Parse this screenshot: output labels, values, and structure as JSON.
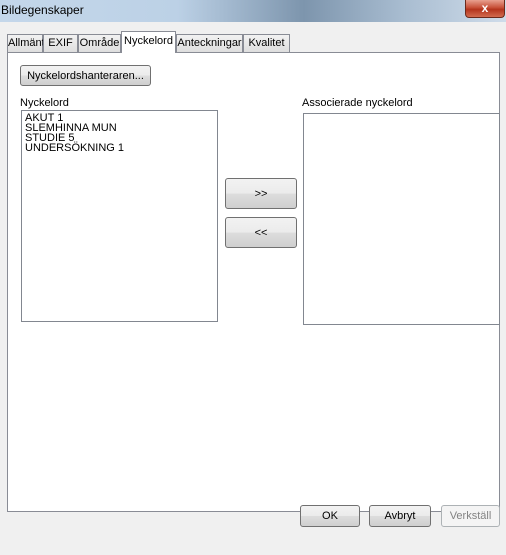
{
  "window": {
    "title": "Bildegenskaper",
    "close_icon": "close-icon",
    "close_glyph": "x"
  },
  "tabs": [
    {
      "label": "Allmänt"
    },
    {
      "label": "EXIF"
    },
    {
      "label": "Område"
    },
    {
      "label": "Nyckelord",
      "active": true
    },
    {
      "label": "Anteckningar"
    },
    {
      "label": "Kvalitet"
    }
  ],
  "panel": {
    "manager_button": "Nyckelordshanteraren...",
    "keywords_label": "Nyckelord",
    "keywords": [
      "AKUT 1",
      "SLEMHINNA MUN",
      "STUDIE 5",
      "UNDERSÖKNING 1"
    ],
    "associated_label": "Associerade nyckelord",
    "associated": [],
    "add_button": ">>",
    "remove_button": "<<"
  },
  "footer": {
    "ok": "OK",
    "cancel": "Avbryt",
    "apply": "Verkställ"
  }
}
